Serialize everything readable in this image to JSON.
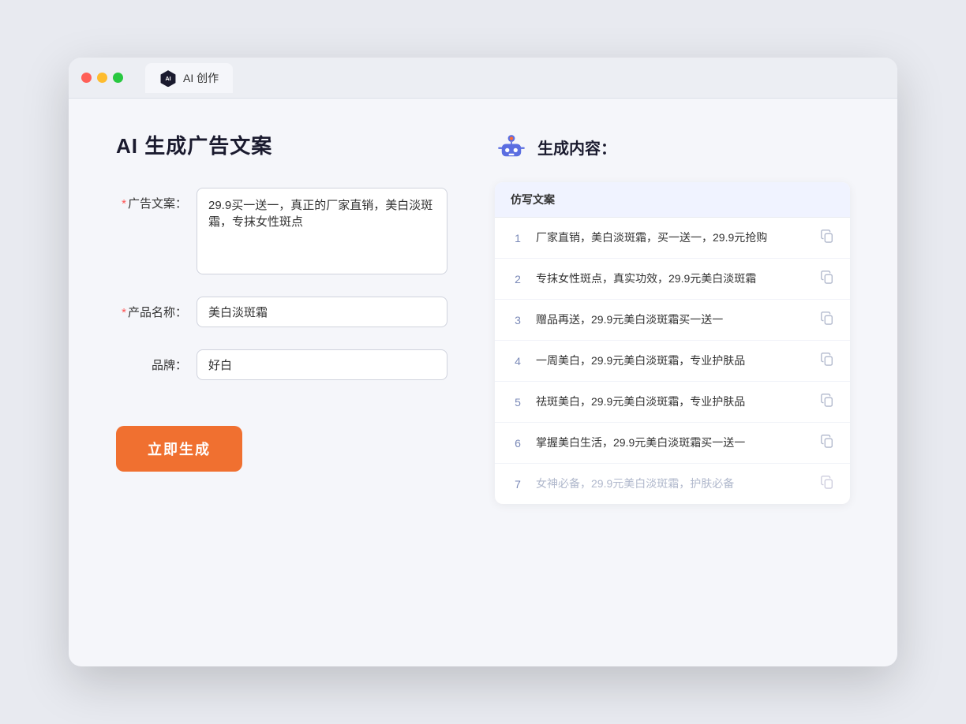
{
  "browser": {
    "tab_label": "AI 创作"
  },
  "page": {
    "title": "AI 生成广告文案",
    "form": {
      "ad_copy_label": "广告文案：",
      "ad_copy_placeholder": "29.9买一送一，真正的厂家直销，美白淡斑霜，专抹女性斑点",
      "product_name_label": "产品名称：",
      "product_name_value": "美白淡斑霜",
      "brand_label": "品牌：",
      "brand_value": "好白",
      "generate_button": "立即生成"
    },
    "result": {
      "title": "生成内容：",
      "table_header": "仿写文案",
      "items": [
        {
          "num": "1",
          "text": "厂家直销，美白淡斑霜，买一送一，29.9元抢购",
          "faded": false
        },
        {
          "num": "2",
          "text": "专抹女性斑点，真实功效，29.9元美白淡斑霜",
          "faded": false
        },
        {
          "num": "3",
          "text": "赠品再送，29.9元美白淡斑霜买一送一",
          "faded": false
        },
        {
          "num": "4",
          "text": "一周美白，29.9元美白淡斑霜，专业护肤品",
          "faded": false
        },
        {
          "num": "5",
          "text": "祛斑美白，29.9元美白淡斑霜，专业护肤品",
          "faded": false
        },
        {
          "num": "6",
          "text": "掌握美白生活，29.9元美白淡斑霜买一送一",
          "faded": false
        },
        {
          "num": "7",
          "text": "女神必备，29.9元美白淡斑霜，护肤必备",
          "faded": true
        }
      ]
    }
  }
}
